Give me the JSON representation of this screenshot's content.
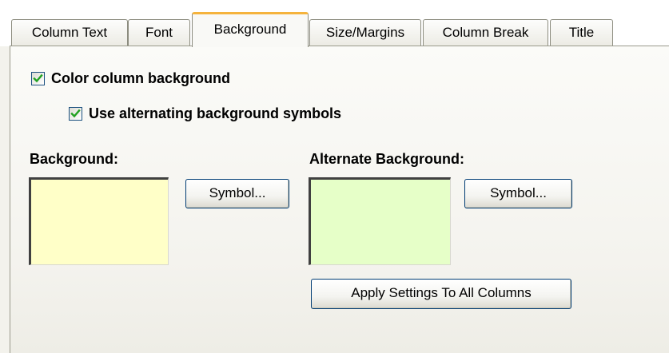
{
  "tabs": [
    {
      "label": "Column Text"
    },
    {
      "label": "Font"
    },
    {
      "label": "Background",
      "active": true
    },
    {
      "label": "Size/Margins"
    },
    {
      "label": "Column Break"
    },
    {
      "label": "Title"
    }
  ],
  "options": {
    "color_column_background": {
      "label": "Color column background",
      "checked": true
    },
    "use_alternating": {
      "label": "Use alternating background symbols",
      "checked": true
    }
  },
  "background": {
    "label": "Background:",
    "color": "#ffffc8",
    "symbol_button": "Symbol..."
  },
  "alternate_background": {
    "label": "Alternate Background:",
    "color": "#e6ffc8",
    "symbol_button": "Symbol..."
  },
  "apply_button": "Apply Settings To All Columns",
  "colors": {
    "check_mark": "#21a121",
    "active_tab_accent": "#f5b33c",
    "button_border": "#003c74"
  },
  "icons": {
    "check": "check-mark-icon"
  }
}
